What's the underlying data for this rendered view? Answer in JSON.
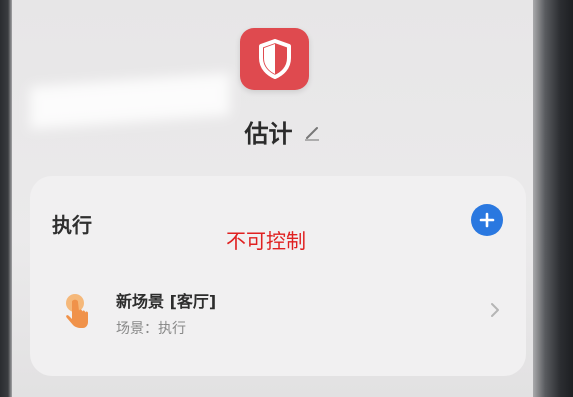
{
  "header": {
    "title": "估计",
    "app_icon": "shield-icon",
    "edit_icon": "pencil-icon"
  },
  "section": {
    "title": "执行",
    "add_icon": "plus-icon"
  },
  "annotation": "不可控制",
  "scene": {
    "name": "新场景 [客厅]",
    "subtitle": "场景：执行",
    "icon": "hand-tap-icon",
    "chevron_icon": "chevron-right-icon"
  },
  "colors": {
    "app_icon_bg": "#df4a4f",
    "add_button": "#2a78e0",
    "annotation": "#e02020",
    "scene_icon": "#f0a45a"
  }
}
